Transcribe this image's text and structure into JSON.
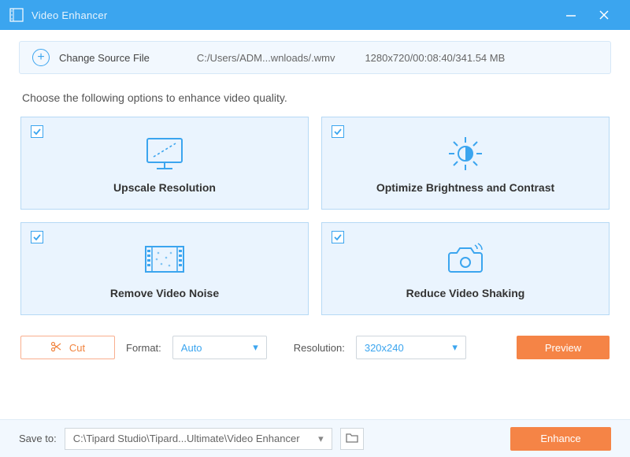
{
  "titlebar": {
    "title": "Video Enhancer"
  },
  "source": {
    "change_label": "Change Source File",
    "path": "C:/Users/ADM...wnloads/.wmv",
    "meta": "1280x720/00:08:40/341.54 MB"
  },
  "instruction": "Choose the following options to enhance video quality.",
  "options": [
    {
      "label": "Upscale Resolution",
      "checked": true
    },
    {
      "label": "Optimize Brightness and Contrast",
      "checked": true
    },
    {
      "label": "Remove Video Noise",
      "checked": true
    },
    {
      "label": "Reduce Video Shaking",
      "checked": true
    }
  ],
  "tools": {
    "cut_label": "Cut",
    "format_label": "Format:",
    "format_value": "Auto",
    "resolution_label": "Resolution:",
    "resolution_value": "320x240",
    "preview_label": "Preview"
  },
  "footer": {
    "save_label": "Save to:",
    "save_path": "C:\\Tipard Studio\\Tipard...Ultimate\\Video Enhancer",
    "enhance_label": "Enhance"
  }
}
